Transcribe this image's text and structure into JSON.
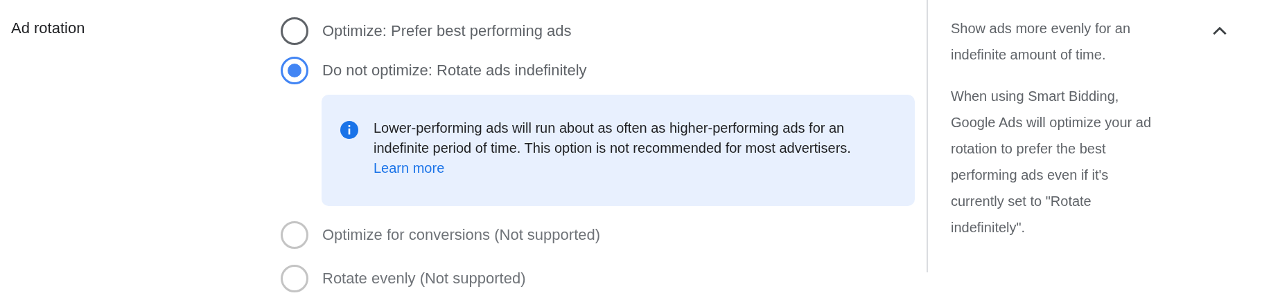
{
  "section": {
    "title": "Ad rotation",
    "expanded": true
  },
  "options": [
    {
      "label": "Optimize: Prefer best performing ads",
      "selected": false,
      "disabled": false
    },
    {
      "label": "Do not optimize: Rotate ads indefinitely",
      "selected": true,
      "disabled": false,
      "info": {
        "text": "Lower-performing ads will run about as often as higher-performing ads for an indefinite period of time. This option is not recommended for most advertisers.",
        "link": "Learn more"
      }
    },
    {
      "label": "Optimize for conversions (Not supported)",
      "selected": false,
      "disabled": true
    },
    {
      "label": "Rotate evenly (Not supported)",
      "selected": false,
      "disabled": true
    }
  ],
  "help": [
    "Show ads more evenly for an indefinite amount of time.",
    "When using Smart Bidding, Google Ads will optimize your ad rotation to prefer the best performing ads even if it's currently set to \"Rotate indefinitely\"."
  ]
}
